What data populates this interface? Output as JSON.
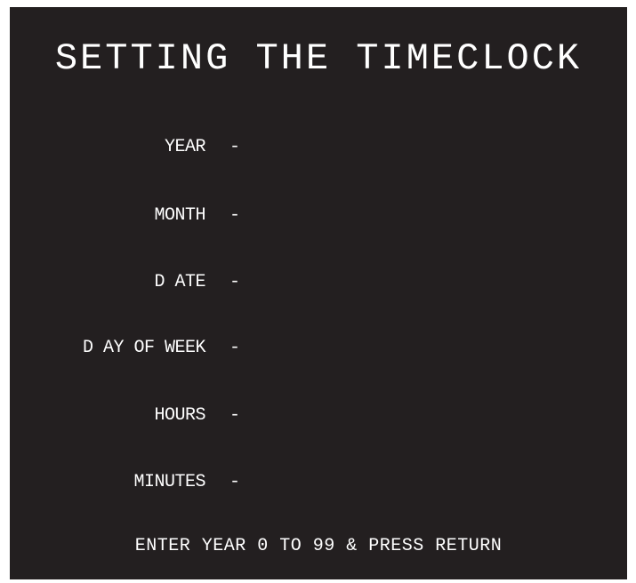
{
  "screen": {
    "title": "SETTING THE TIMECLOCK",
    "fields": [
      {
        "label": "YEAR",
        "separator": "-",
        "value": ""
      },
      {
        "label": "MONTH",
        "separator": "-",
        "value": ""
      },
      {
        "label": "D ATE",
        "separator": "-",
        "value": ""
      },
      {
        "label": "D AY OF WEEK",
        "separator": "-",
        "value": ""
      },
      {
        "label": "HOURS",
        "separator": "-",
        "value": ""
      },
      {
        "label": "MINUTES",
        "separator": "-",
        "value": ""
      }
    ],
    "prompt": "ENTER YEAR 0 TO 99 & PRESS RETURN",
    "colors": {
      "background": "#231f20",
      "text": "#ffffff",
      "page": "#ffffff"
    }
  }
}
